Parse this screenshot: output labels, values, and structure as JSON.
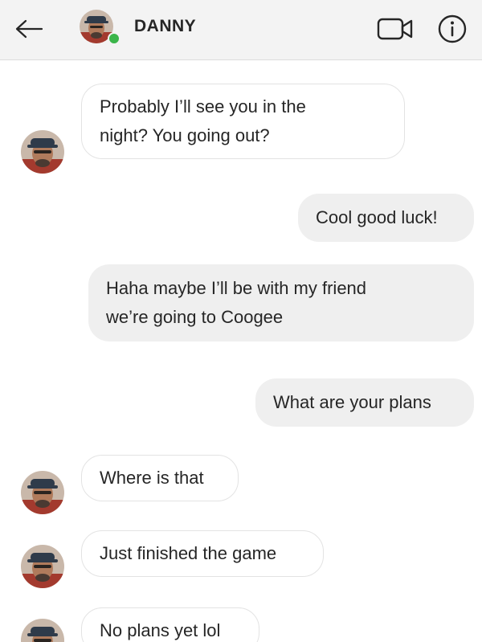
{
  "header": {
    "back_icon": "arrow-left-icon",
    "contact_name": "DANNY",
    "online": true,
    "video_icon": "video-camera-icon",
    "info_icon": "info-circle-icon"
  },
  "colors": {
    "header_bg": "#f3f3f3",
    "incoming_bubble_bg": "#ffffff",
    "incoming_bubble_border": "#e3e3e3",
    "outgoing_bubble_bg": "#efefef",
    "online_indicator": "#3bb54a",
    "text": "#262626"
  },
  "messages": [
    {
      "direction": "incoming",
      "lines": [
        "Probably I’ll see you in the",
        "night? You going out?"
      ]
    },
    {
      "direction": "outgoing",
      "lines": [
        "Cool good luck!"
      ]
    },
    {
      "direction": "outgoing",
      "lines": [
        "Haha maybe I’ll be with my friend",
        "we’re going to Coogee"
      ]
    },
    {
      "direction": "outgoing",
      "lines": [
        "What are your plans"
      ]
    },
    {
      "direction": "incoming",
      "lines": [
        "Where is that"
      ]
    },
    {
      "direction": "incoming",
      "lines": [
        "Just finished the game"
      ]
    },
    {
      "direction": "incoming",
      "lines": [
        "No plans yet lol"
      ]
    }
  ]
}
